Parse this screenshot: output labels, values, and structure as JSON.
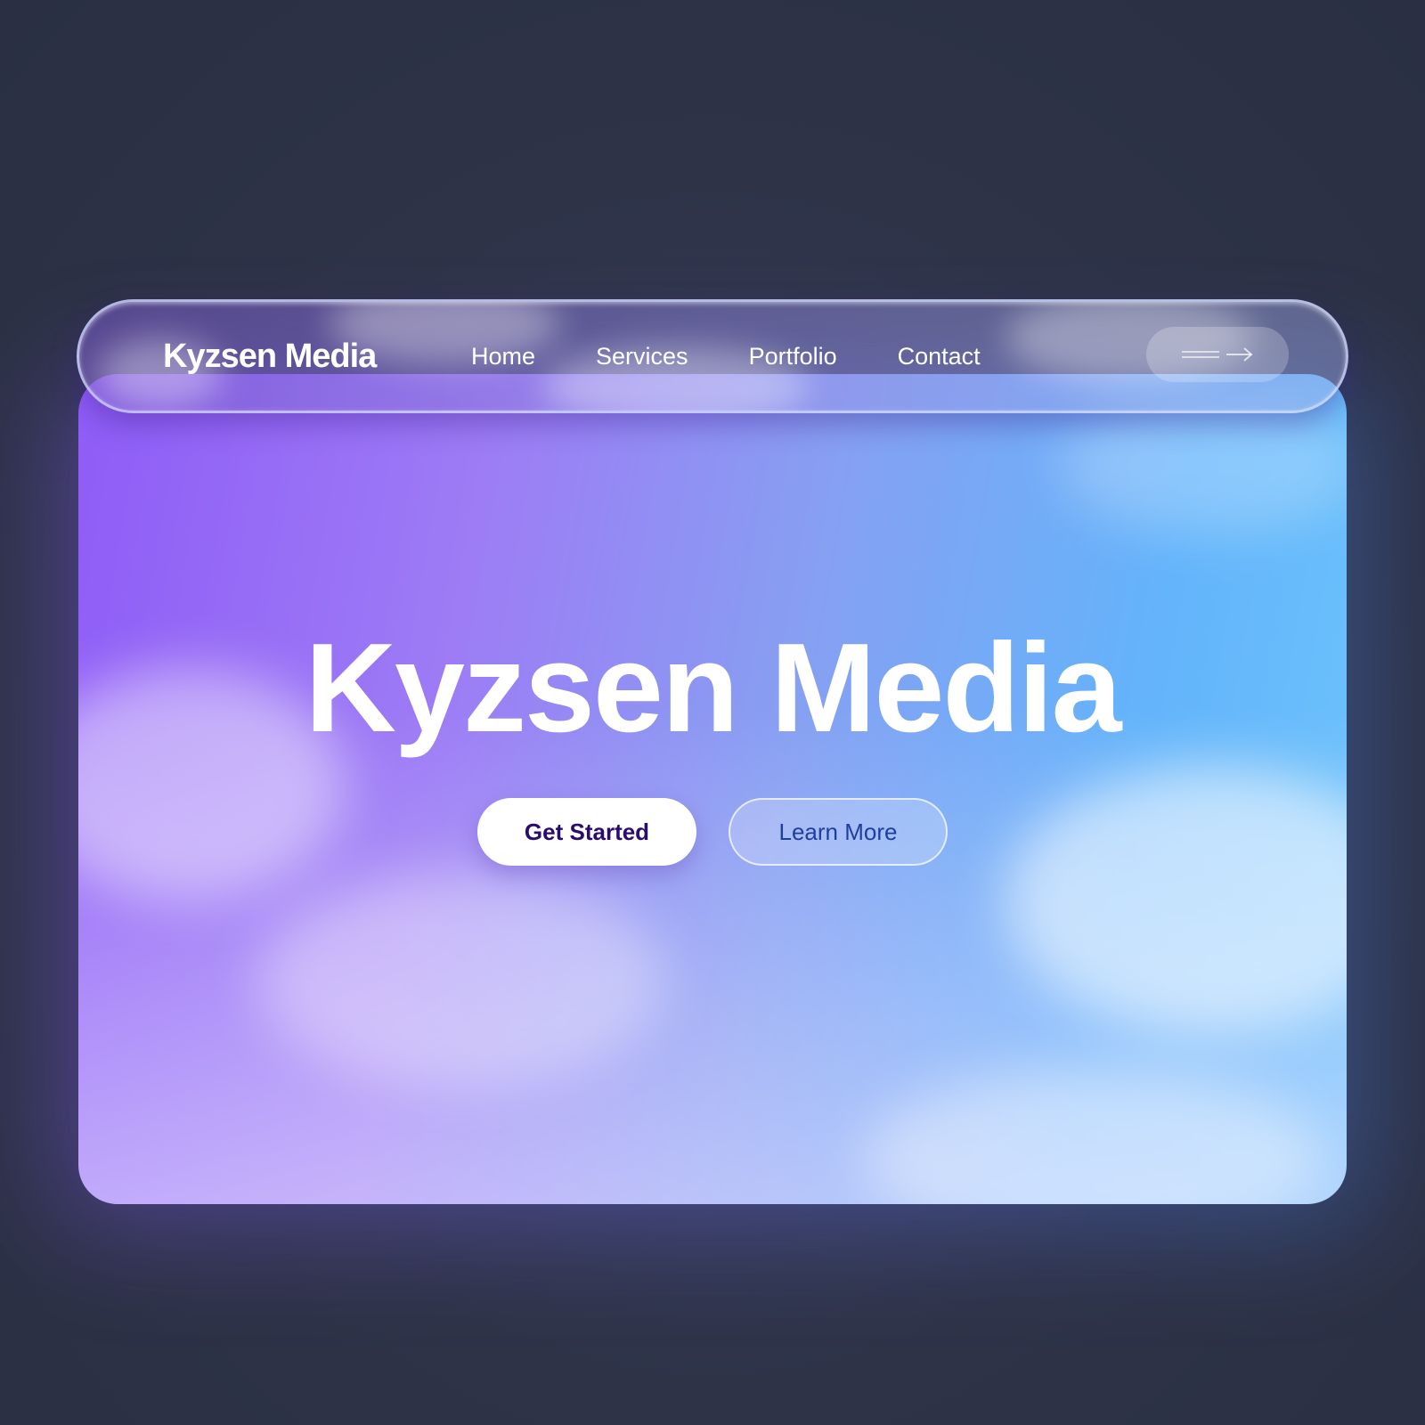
{
  "nav": {
    "brand": "Kyzsen Media",
    "links": [
      "Home",
      "Services",
      "Portfolio",
      "Contact"
    ],
    "action_icon": "arrow-right-icon"
  },
  "hero": {
    "title": "Kyzsen Media",
    "primary_cta": "Get Started",
    "secondary_cta": "Learn More"
  },
  "colors": {
    "gradient_start": "#8f5cf7",
    "gradient_end": "#63b4fb",
    "primary_cta_text": "#2a0b6e",
    "secondary_cta_text": "#1f3fa0"
  }
}
